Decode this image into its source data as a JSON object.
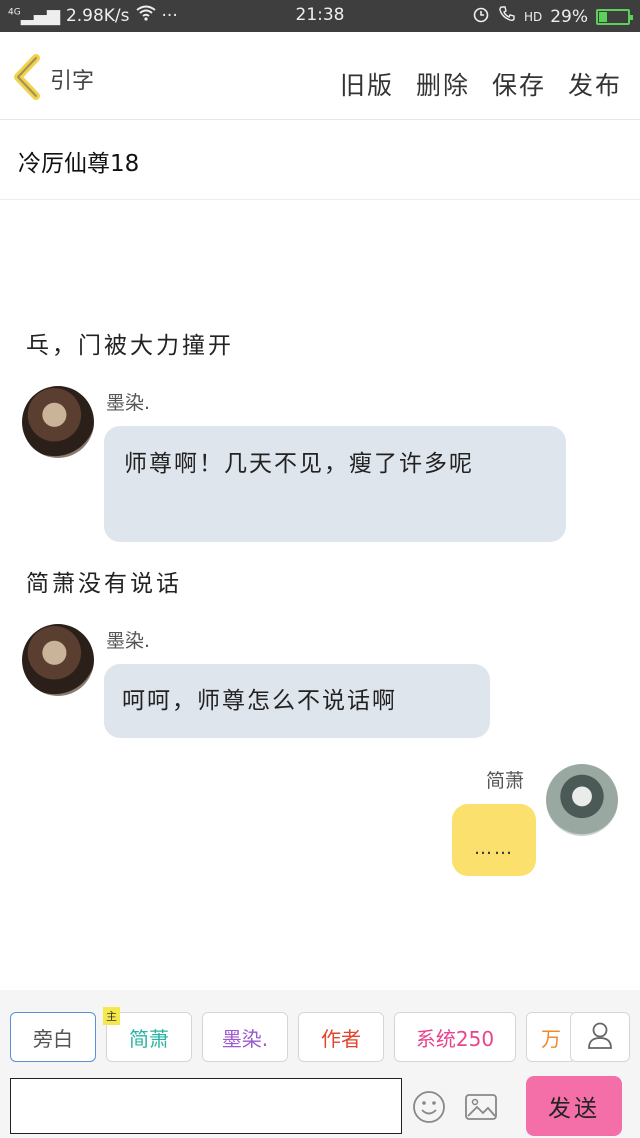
{
  "status_bar": {
    "network": "4G",
    "speed": "2.98K/s",
    "dots": "···",
    "time": "21:38",
    "hd": "HD",
    "battery": "29%",
    "battery_level": 0.29
  },
  "header": {
    "back_label": "引字",
    "actions": [
      "旧版",
      "删除",
      "保存",
      "发布"
    ]
  },
  "story": {
    "title": "冷厉仙尊18"
  },
  "messages": {
    "narration_1": "乓，门被大力撞开",
    "speaker_1": "墨染.",
    "bubble_1": "师尊啊！几天不见，瘦了许多呢",
    "narration_2": "简萧没有说话",
    "speaker_2": "墨染.",
    "bubble_2": "呵呵，师尊怎么不说话啊",
    "speaker_3": "简萧",
    "bubble_3": "……"
  },
  "characters": {
    "items": [
      {
        "label": "旁白",
        "color": "#555555"
      },
      {
        "label": "简萧",
        "color": "#2bb3a3",
        "tag": "主"
      },
      {
        "label": "墨染.",
        "color": "#9b59d0"
      },
      {
        "label": "作者",
        "color": "#e0442f"
      },
      {
        "label": "系统250",
        "color": "#e8458e"
      },
      {
        "label": "万",
        "color": "#f08a2c"
      }
    ]
  },
  "input": {
    "value": "",
    "send_label": "发送"
  },
  "icons": {
    "back": "chevron-left-icon",
    "wifi": "wifi-icon",
    "alarm": "alarm-icon",
    "call": "call-icon",
    "user": "user-icon",
    "emoji": "emoji-icon",
    "image": "image-icon"
  },
  "colors": {
    "bubble_left": "#dfe5ec",
    "bubble_right": "#fbe06e",
    "send_button": "#f46fa7",
    "back_chevron": "#f2d24a",
    "battery": "#5bd05b"
  }
}
